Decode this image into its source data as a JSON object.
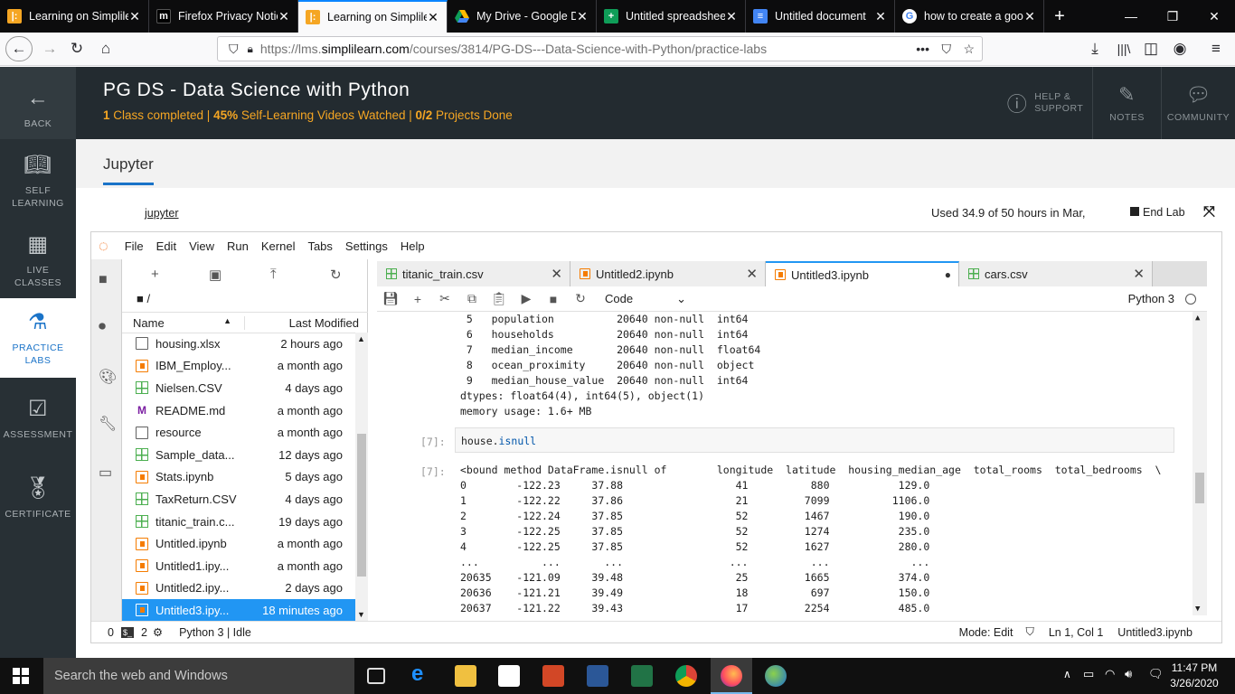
{
  "browser": {
    "tabs": [
      {
        "title": "Learning on Simplile",
        "favicon": "simplilearn-icon",
        "color": "#f5a623",
        "active": false
      },
      {
        "title": "Firefox Privacy Notic",
        "favicon": "mozilla-icon",
        "color": "#000000",
        "active": false
      },
      {
        "title": "Learning on Simplile",
        "favicon": "simplilearn-icon",
        "color": "#f5a623",
        "active": true
      },
      {
        "title": "My Drive - Google D",
        "favicon": "drive-icon",
        "color": "#1fa463",
        "active": false
      },
      {
        "title": "Untitled spreadshee",
        "favicon": "sheets-icon",
        "color": "#0f9d58",
        "active": false
      },
      {
        "title": "Untitled document",
        "favicon": "docs-icon",
        "color": "#4285f4",
        "active": false
      },
      {
        "title": "how to create a goo",
        "favicon": "google-icon",
        "color": "#ffffff",
        "active": false
      }
    ],
    "url_prefix": "https://lms.",
    "url_domain": "simplilearn.com",
    "url_path": "/courses/3814/PG-DS---Data-Science-with-Python/practice-labs"
  },
  "rail": [
    {
      "label": "BACK",
      "icon": "back-arrow-icon"
    },
    {
      "label": "SELF LEARNING",
      "icon": "book-icon"
    },
    {
      "label": "LIVE CLASSES",
      "icon": "calendar-icon"
    },
    {
      "label": "PRACTICE LABS",
      "icon": "flask-icon",
      "selected": true
    },
    {
      "label": "ASSESSMENT",
      "icon": "checklist-icon"
    },
    {
      "label": "CERTIFICATE",
      "icon": "certificate-icon"
    }
  ],
  "header": {
    "title": "PG DS - Data Science with Python",
    "p1": "1",
    "p1t": " Class completed | ",
    "p2": "45%",
    "p2t": " Self-Learning Videos Watched  | ",
    "p3": "0/2",
    "p3t": " Projects Done",
    "help": "HELP &",
    "help2": "SUPPORT",
    "notes": "NOTES",
    "community": "COMMUNITY"
  },
  "lab": {
    "section_title": "Jupyter",
    "jupyter_link": "jupyter",
    "usage": "Used 34.9 of 50 hours in Mar,",
    "end_lab": "End Lab"
  },
  "menu": [
    "File",
    "Edit",
    "View",
    "Run",
    "Kernel",
    "Tabs",
    "Settings",
    "Help"
  ],
  "filebrowser": {
    "path": "/",
    "col_name": "Name",
    "col_modified": "Last Modified",
    "files": [
      {
        "name": "housing.xlsx",
        "modified": "2 hours ago",
        "type": "doc"
      },
      {
        "name": "IBM_Employ...",
        "modified": "a month ago",
        "type": "nb"
      },
      {
        "name": "Nielsen.CSV",
        "modified": "4 days ago",
        "type": "csv"
      },
      {
        "name": "README.md",
        "modified": "a month ago",
        "type": "md"
      },
      {
        "name": "resource",
        "modified": "a month ago",
        "type": "doc"
      },
      {
        "name": "Sample_data...",
        "modified": "12 days ago",
        "type": "csv"
      },
      {
        "name": "Stats.ipynb",
        "modified": "5 days ago",
        "type": "nb"
      },
      {
        "name": "TaxReturn.CSV",
        "modified": "4 days ago",
        "type": "csv"
      },
      {
        "name": "titanic_train.c...",
        "modified": "19 days ago",
        "type": "csv"
      },
      {
        "name": "Untitled.ipynb",
        "modified": "a month ago",
        "type": "nb"
      },
      {
        "name": "Untitled1.ipy...",
        "modified": "a month ago",
        "type": "nb"
      },
      {
        "name": "Untitled2.ipy...",
        "modified": "2 days ago",
        "type": "nb"
      },
      {
        "name": "Untitled3.ipy...",
        "modified": "18 minutes ago",
        "type": "nb",
        "selected": true
      }
    ]
  },
  "doctabs": [
    {
      "title": "titanic_train.csv",
      "type": "csv"
    },
    {
      "title": "Untitled2.ipynb",
      "type": "nb"
    },
    {
      "title": "Untitled3.ipynb",
      "type": "nb",
      "active": true
    },
    {
      "title": "cars.csv",
      "type": "csv"
    }
  ],
  "toolbar": {
    "cell_type": "Code",
    "kernel": "Python 3"
  },
  "notebook": {
    "out_prev": " 5   population          20640 non-null  int64\n 6   households          20640 non-null  int64\n 7   median_income       20640 non-null  float64\n 8   ocean_proximity     20640 non-null  object\n 9   median_house_value  20640 non-null  int64\ndtypes: float64(4), int64(5), object(1)\nmemory usage: 1.6+ MB",
    "in_prompt": "[7]:",
    "code_var": "house.",
    "code_attr": "isnull",
    "out_prompt": "[7]:",
    "out_text": "<bound method DataFrame.isnull of        longitude  latitude  housing_median_age  total_rooms  total_bedrooms  \\\n0        -122.23     37.88                  41          880           129.0\n1        -122.22     37.86                  21         7099          1106.0\n2        -122.24     37.85                  52         1467           190.0\n3        -122.25     37.85                  52         1274           235.0\n4        -122.25     37.85                  52         1627           280.0\n...          ...       ...                 ...          ...             ...\n20635    -121.09     39.48                  25         1665           374.0\n20636    -121.21     39.49                  18          697           150.0\n20637    -121.22     39.43                  17         2254           485.0"
  },
  "status": {
    "terminals": "0",
    "kernels": "2",
    "kernel_state": "Python 3 | Idle",
    "mode": "Mode: Edit",
    "position": "Ln 1, Col 1",
    "file": "Untitled3.ipynb"
  },
  "taskbar": {
    "search_placeholder": "Search the web and Windows",
    "time": "11:47 PM",
    "date": "3/26/2020"
  }
}
